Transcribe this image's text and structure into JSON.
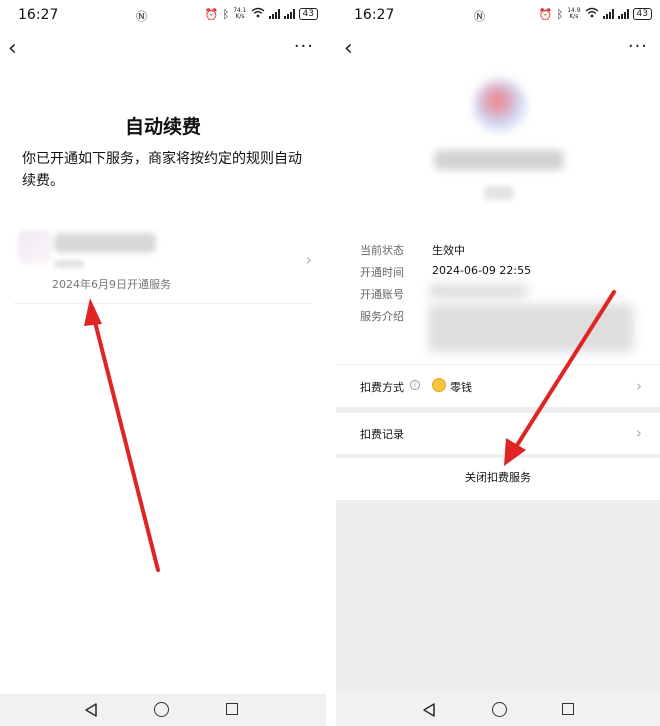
{
  "status_bar": {
    "time": "16:27",
    "left_speed_value": "74.1",
    "right_speed_value": "14.9",
    "speed_unit": "K/s",
    "battery": "43"
  },
  "left_page": {
    "title": "自动续费",
    "subtitle": "你已开通如下服务，商家将按约定的规则自动续费。",
    "service": {
      "open_date_text": "2024年6月9日开通服务"
    }
  },
  "right_page": {
    "info": [
      {
        "label": "当前状态",
        "value": "生效中"
      },
      {
        "label": "开通时间",
        "value": "2024-06-09 22:55"
      },
      {
        "label": "开通账号",
        "value": ""
      },
      {
        "label": "服务介绍",
        "value": ""
      }
    ],
    "payment_method_label": "扣费方式",
    "payment_method_value": "零钱",
    "deduction_records_label": "扣费记录",
    "close_service_label": "关闭扣费服务"
  },
  "colors": {
    "annotation_arrow": "#e02424",
    "coin": "#f7c63a",
    "gray_background": "#eeeeee"
  }
}
